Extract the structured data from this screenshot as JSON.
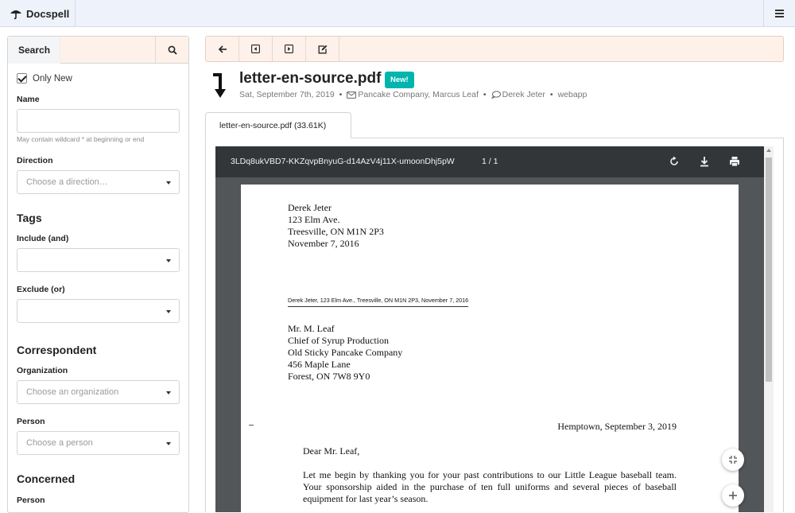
{
  "app": {
    "name": "Docspell"
  },
  "sidebar": {
    "search_label": "Search",
    "only_new_label": "Only New",
    "only_new_checked": true,
    "name_label": "Name",
    "name_value": "",
    "name_hint": "May contain wildcard * at beginning or end",
    "direction_label": "Direction",
    "direction_placeholder": "Choose a direction…",
    "tags_title": "Tags",
    "include_label": "Include (and)",
    "exclude_label": "Exclude (or)",
    "correspondent_title": "Correspondent",
    "organization_label": "Organization",
    "organization_placeholder": "Choose an organization",
    "person_label": "Person",
    "person_placeholder": "Choose a person",
    "concerned_title": "Concerned",
    "concerned_person_label": "Person"
  },
  "document": {
    "title": "letter-en-source.pdf",
    "badge": "New!",
    "date": "Sat, September 7th, 2019",
    "correspondent": "Pancake Company, Marcus Leaf",
    "concerned": "Derek Jeter",
    "source": "webapp",
    "tab_label": "letter-en-source.pdf (33.61K)"
  },
  "viewer": {
    "file_id": "3LDq8ukVBD7-KKZqvpBnyuG-d14AzV4j11X-umoonDhj5pW",
    "page_indicator": "1 / 1"
  },
  "letter": {
    "sender_lines": [
      "Derek Jeter",
      "123 Elm Ave.",
      "Treesville, ON M1N 2P3",
      "November 7, 2016"
    ],
    "return_address": "Derek Jeter, 123 Elm Ave., Treesville, ON M1N 2P3, November 7, 2016",
    "recipient_lines": [
      "Mr. M. Leaf",
      "Chief of Syrup Production",
      "Old Sticky Pancake Company",
      "456 Maple Lane",
      "Forest, ON 7W8 9Y0"
    ],
    "place_date": "Hemptown, September 3, 2019",
    "salutation": "Dear Mr. Leaf,",
    "body": "Let me begin by thanking you for your past contributions to our Little League baseball team. Your sponsorship aided in the purchase of ten full uniforms and several pieces of baseball equipment for last year’s season."
  },
  "colors": {
    "topbar_bg": "#eef3fb",
    "toolbar_bg": "#fdf1ea",
    "badge_bg": "#00b5ad",
    "viewer_bar": "#323639",
    "viewer_bg": "#525659"
  }
}
